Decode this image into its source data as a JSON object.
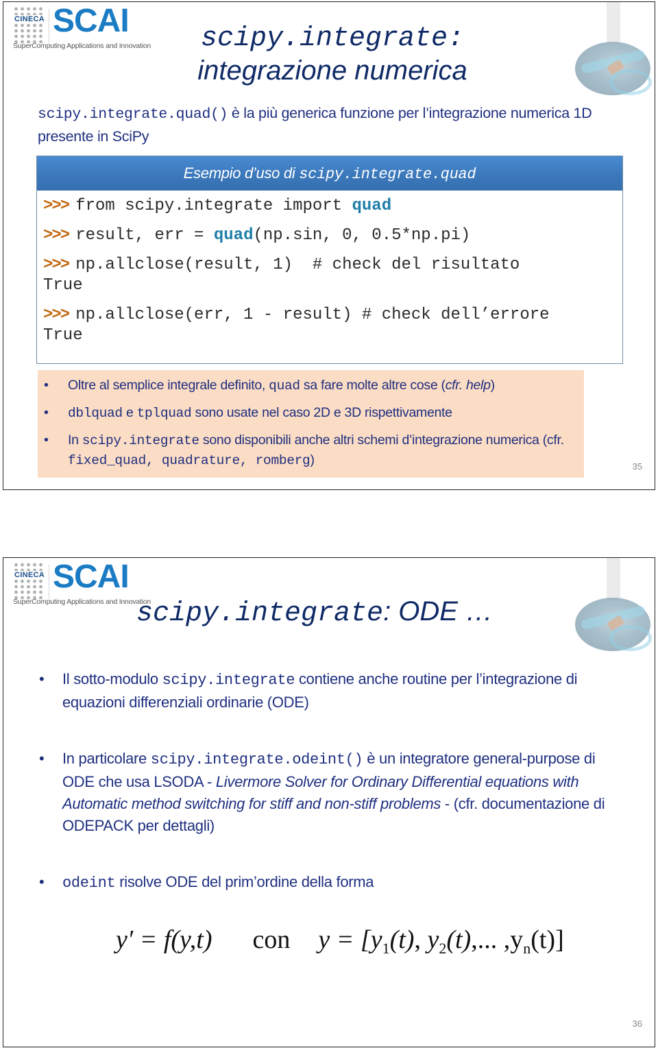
{
  "slides": [
    {
      "logo": {
        "org": "CINECA",
        "brand": "SCAI",
        "tagline": "SuperComputing Applications and Innovation"
      },
      "title": {
        "line1": "scipy.integrate:",
        "line2": "integrazione numerica"
      },
      "intro": {
        "code": "scipy.integrate.quad()",
        "text": " è la più generica funzione per l’integrazione numerica 1D presente in SciPy"
      },
      "example_box": {
        "header_text": "Esempio d’uso di ",
        "header_code": "scipy.integrate.quad",
        "prompt": ">>>",
        "lines": [
          {
            "prompt": true,
            "parts": [
              {
                "t": "from scipy.integrate import "
              },
              {
                "t": "quad",
                "kw": true
              }
            ]
          },
          {
            "prompt": true,
            "parts": [
              {
                "t": "result, err = "
              },
              {
                "t": "quad",
                "kw": true
              },
              {
                "t": "(np.sin, 0, 0.5*np.pi)"
              }
            ]
          },
          {
            "prompt": true,
            "parts": [
              {
                "t": "np.allclose(result, 1)  # check del risultato"
              }
            ]
          },
          {
            "prompt": false,
            "parts": [
              {
                "t": "True"
              }
            ]
          },
          {
            "prompt": true,
            "parts": [
              {
                "t": "np.allclose(err, 1 - result) # check dell’errore"
              }
            ]
          },
          {
            "prompt": false,
            "parts": [
              {
                "t": "True"
              }
            ]
          }
        ]
      },
      "notes": {
        "bullet": "•",
        "items": [
          {
            "a": "Oltre al semplice integrale definito, ",
            "code": "quad",
            "b": " sa fare molte altre cose (",
            "i": "cfr. help",
            "c": ")"
          },
          {
            "code1": "dblquad",
            "a": " e ",
            "code2": "tplquad",
            "b": " sono usate nel caso 2D e 3D rispettivamente"
          },
          {
            "a": "In ",
            "code": "scipy.integrate",
            "b": " sono disponibili anche altri schemi d’integrazione numerica (cfr. ",
            "code2": "fixed_quad, quadrature, romberg",
            "c": ")"
          }
        ]
      },
      "page_number": "35"
    },
    {
      "logo": {
        "org": "CINECA",
        "brand": "SCAI",
        "tagline": "SuperComputing Applications and Innovation"
      },
      "title": {
        "code": "scipy.integrate",
        "rest": ": ODE …"
      },
      "bullet": "•",
      "items": [
        {
          "a": "Il sotto-modulo ",
          "code": "scipy.integrate",
          "b": " contiene anche routine per l’integrazione di equazioni differenziali ordinarie (ODE)"
        },
        {
          "a": "In particolare ",
          "code": "scipy.integrate.odeint()",
          "b": " è un integratore general-purpose di ODE che usa LSODA - ",
          "i": "Livermore Solver for Ordinary Differential equations with Automatic method switching for stiff and non-stiff problems",
          "c": " - (cfr. documentazione di ODEPACK per dettagli)"
        },
        {
          "code": "odeint",
          "b": " risolve ODE del prim’ordine della forma"
        }
      ],
      "formula": {
        "lhs": "y′ = f(y,t)",
        "con": "con",
        "rhs_prefix": "y = [",
        "y1": "y",
        "s1": "1",
        "y2": "y",
        "s2": "2",
        "yn": "y",
        "sn": "n",
        "t": "(t)",
        "tn": "(t)",
        "ellipsis": ",... ,",
        "close": "]"
      },
      "page_number": "36"
    }
  ]
}
